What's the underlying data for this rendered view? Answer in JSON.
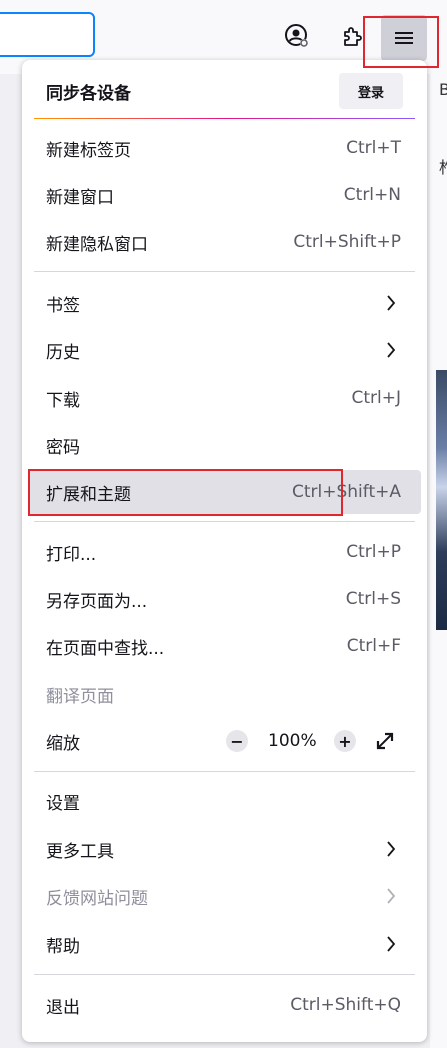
{
  "menu": {
    "header_title": "同步各设备",
    "signin_label": "登录",
    "group1": [
      {
        "label": "新建标签页",
        "shortcut": "Ctrl+T"
      },
      {
        "label": "新建窗口",
        "shortcut": "Ctrl+N"
      },
      {
        "label": "新建隐私窗口",
        "shortcut": "Ctrl+Shift+P"
      }
    ],
    "group2": [
      {
        "label": "书签"
      },
      {
        "label": "历史"
      },
      {
        "label": "下载",
        "shortcut": "Ctrl+J"
      },
      {
        "label": "密码"
      },
      {
        "label": "扩展和主题",
        "shortcut": "Ctrl+Shift+A"
      }
    ],
    "group3": [
      {
        "label": "打印...",
        "shortcut": "Ctrl+P"
      },
      {
        "label": "另存页面为...",
        "shortcut": "Ctrl+S"
      },
      {
        "label": "在页面中查找...",
        "shortcut": "Ctrl+F"
      },
      {
        "label": "翻译页面"
      },
      {
        "label": "缩放"
      }
    ],
    "zoom": {
      "minus": "−",
      "value": "100%",
      "plus": "+"
    },
    "group4": [
      {
        "label": "设置"
      },
      {
        "label": "更多工具"
      },
      {
        "label": "反馈网站问题"
      },
      {
        "label": "帮助"
      }
    ],
    "group5": [
      {
        "label": "退出",
        "shortcut": "Ctrl+Shift+Q"
      }
    ]
  },
  "background": {
    "glyph_1": "B",
    "glyph_2": "柞"
  },
  "colors": {
    "highlight_box": "#e0262e",
    "active_item_bg": "#e0e0e6",
    "urlbar_focus": "#0a84ff"
  }
}
